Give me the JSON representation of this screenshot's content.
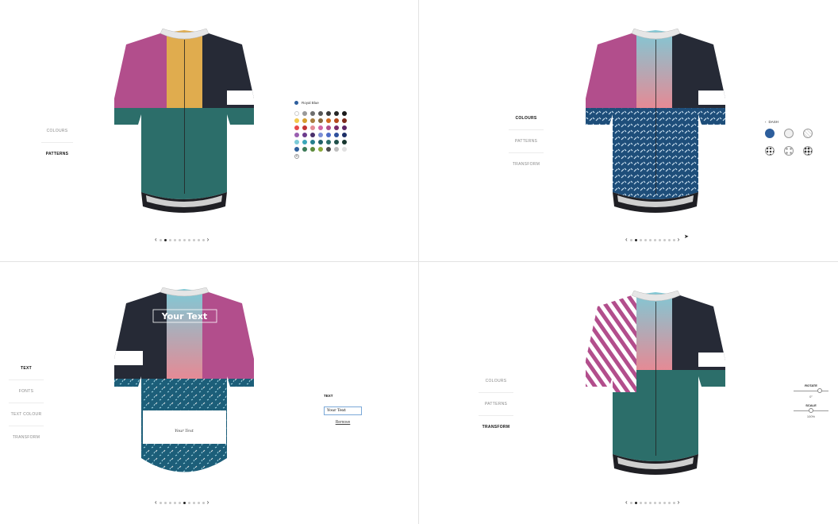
{
  "colors": {
    "magenta": "#b24e8c",
    "mustard": "#e0ac4e",
    "navy": "#262a36",
    "teal": "#2c6e6a",
    "white": "#ffffff",
    "pink": "#e58a95",
    "cyan": "#7ccbd8",
    "collar_grey": "#e6e6e6",
    "hem_grey": "#cfcfcf",
    "selected_blue": "#2d5e9c"
  },
  "q1": {
    "menu": [
      "COLOURS",
      "PATTERNS"
    ],
    "active": 1,
    "selected_colour": "Royal Blue",
    "swatches": [
      "#ffffff",
      "#9a9a9a",
      "#6e6e6e",
      "#575757",
      "#3a3a3a",
      "#262626",
      "#1a1a1a",
      "#f2c94c",
      "#d69e2e",
      "#a97d3f",
      "#8a6a3d",
      "#d46a1f",
      "#b54a1c",
      "#7d2a1c",
      "#e84a4a",
      "#c13434",
      "#e58a95",
      "#d163a5",
      "#b24e8c",
      "#7a2b6a",
      "#5c2566",
      "#9a5fb0",
      "#6b3b8c",
      "#49306b",
      "#7c8fd6",
      "#4d6bc7",
      "#2d4f9c",
      "#1c2e66",
      "#7ccbd8",
      "#3aa6b9",
      "#247e8c",
      "#1f5e66",
      "#2c6e6a",
      "#1f4f4a",
      "#17362f",
      "#2d5e9c",
      "#3b7a57",
      "#5c8a3a",
      "#8aa83a",
      "#4a4a4a",
      "#bdbdbd",
      "#e0e0e0"
    ],
    "pager_active": 1
  },
  "q2": {
    "menu": [
      "COLOURS",
      "PATTERNS",
      "TRANSFORM"
    ],
    "active": 0,
    "pattern_label": "DASH",
    "pager_active": 1
  },
  "q3": {
    "menu": [
      "TEXT",
      "FONTS",
      "TEXT COLOUR",
      "TRANSFORM"
    ],
    "active": 0,
    "text_label": "TEXT",
    "text_value": "Your Text",
    "remove_label": "Remove",
    "jersey_text": "Your Text",
    "pager_active": 5
  },
  "q4": {
    "menu": [
      "COLOURS",
      "PATTERNS",
      "TRANSFORM"
    ],
    "active": 2,
    "rotate_label": "ROTATE",
    "rotate_value": "0°",
    "rotate_level": 0.75,
    "scale_label": "SCALE",
    "scale_value": "100%",
    "scale_level": 0.5,
    "pager_active": 1
  }
}
